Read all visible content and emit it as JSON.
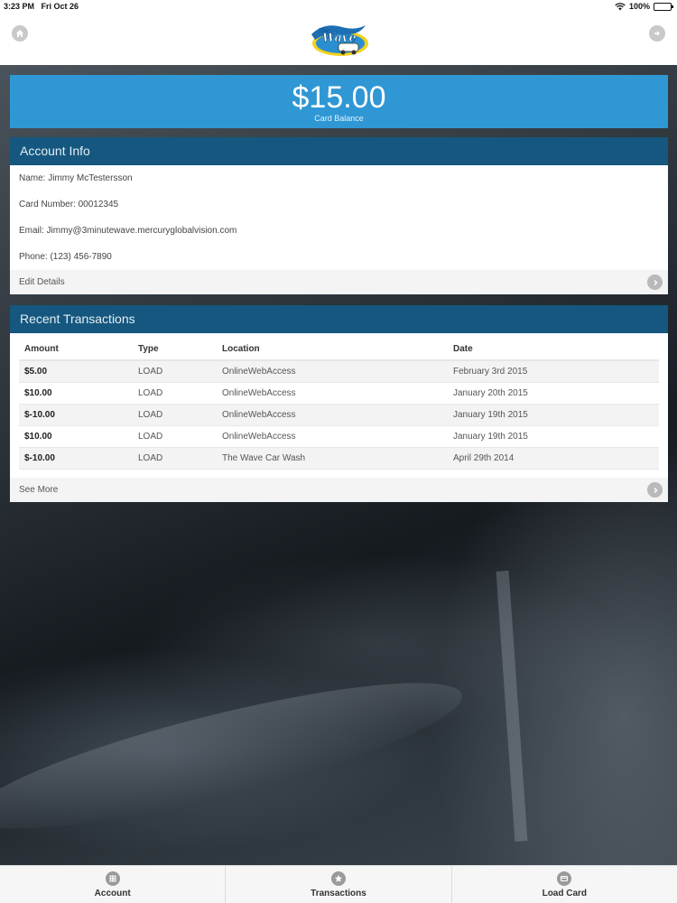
{
  "status_bar": {
    "time": "3:23 PM",
    "date": "Fri Oct 26",
    "battery": "100%"
  },
  "header": {
    "logo_text": "The Wave",
    "home_icon": "home-icon",
    "exit_icon": "exit-icon"
  },
  "balance": {
    "amount": "$15.00",
    "label": "Card Balance",
    "color": "#2f97d4"
  },
  "account_info": {
    "title": "Account Info",
    "name": "Name: Jimmy McTestersson",
    "card_number": "Card Number: 00012345",
    "email": "Email: Jimmy@3minutewave.mercuryglobalvision.com",
    "phone": "Phone: (123) 456-7890",
    "edit_label": "Edit Details"
  },
  "transactions": {
    "title": "Recent Transactions",
    "columns": [
      "Amount",
      "Type",
      "Location",
      "Date"
    ],
    "rows": [
      [
        "$5.00",
        "LOAD",
        "OnlineWebAccess",
        "February 3rd 2015"
      ],
      [
        "$10.00",
        "LOAD",
        "OnlineWebAccess",
        "January 20th 2015"
      ],
      [
        "$-10.00",
        "LOAD",
        "OnlineWebAccess",
        "January 19th 2015"
      ],
      [
        "$10.00",
        "LOAD",
        "OnlineWebAccess",
        "January 19th 2015"
      ],
      [
        "$-10.00",
        "LOAD",
        "The Wave Car Wash",
        "April 29th 2014"
      ]
    ],
    "see_more_label": "See More"
  },
  "tabs": [
    {
      "label": "Account",
      "icon": "grid-icon"
    },
    {
      "label": "Transactions",
      "icon": "star-icon"
    },
    {
      "label": "Load Card",
      "icon": "card-icon"
    }
  ],
  "colors": {
    "header_bar": "#15577f",
    "accent": "#2f97d4"
  }
}
